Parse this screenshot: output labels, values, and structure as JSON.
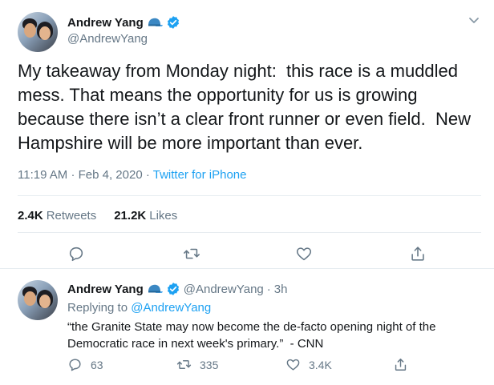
{
  "main_tweet": {
    "author_name": "Andrew Yang",
    "handle": "@AndrewYang",
    "text": "My takeaway from Monday night:  this race is a muddled mess. That means the opportunity for us is growing because there isn’t a clear front runner or even field.  New Hampshire will be more important than ever.",
    "time": "11:19 AM",
    "date": "Feb 4, 2020",
    "source": "Twitter for iPhone",
    "separator": "·",
    "retweets_count": "2.4K",
    "retweets_label": "Retweets",
    "likes_count": "21.2K",
    "likes_label": "Likes"
  },
  "reply_tweet": {
    "author_name": "Andrew Yang",
    "handle": "@AndrewYang",
    "separator": "·",
    "age": "3h",
    "replying_to_label": "Replying to",
    "replying_to_handle": "@AndrewYang",
    "text": "“the Granite State may now become the de-facto opening night of the Democratic race in next week's primary.”  - CNN",
    "reply_count": "63",
    "retweet_count": "335",
    "like_count": "3.4K"
  },
  "colors": {
    "accent": "#1da1f2",
    "secondary_text": "#657786",
    "primary_text": "#14171a",
    "divider": "#e6ecf0"
  },
  "icons": {
    "verified": "verified-badge-icon",
    "cap": "blue-cap-emoji-icon",
    "menu": "chevron-down-icon",
    "reply": "comment-icon",
    "retweet": "retweet-icon",
    "like": "heart-icon",
    "share": "share-icon"
  }
}
